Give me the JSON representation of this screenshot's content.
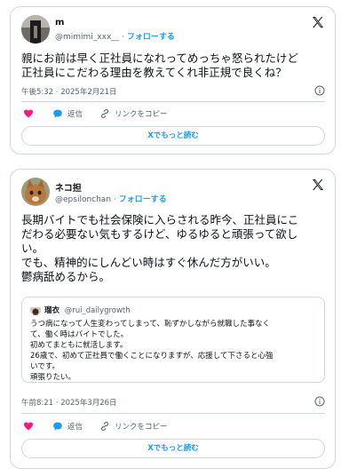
{
  "tweets": [
    {
      "user": {
        "name": "m",
        "handle": "@mimimi_xxx__",
        "follow_label": "フォローする"
      },
      "text": "親にお前は早く正社員になれってめっちゃ怒られたけど\n正社員にこだわる理由を教えてくれ非正規で良くね？",
      "timestamp": "午後5:32 · 2025年2月21日",
      "actions": {
        "reply": "返信",
        "copy_link": "リンクをコピー"
      },
      "read_more": "Xでもっと読む"
    },
    {
      "user": {
        "name": "ネコ担",
        "handle": "@epsilonchan",
        "follow_label": "フォローする"
      },
      "text": "長期バイトでも社会保険に入らされる昨今、正社員にこ\nだわる必要ない気もするけど、ゆるゆると頑張って欲し\nい。\nでも、精神的にしんどい時はすぐ休んだ方がいい。\n鬱病舐めるから。",
      "quote": {
        "name": "瑠衣",
        "handle": "@rui_dailygrowth",
        "text": "うつ病になって人生変わってしまって、恥ずかしながら就職した事なく\nて、働く時はバイトでした。\n初めてまともに就活します。\n26歳で、初めて正社員で働くことになりますが、応援して下さると心強\nいです。\n頑張りたい。"
      },
      "timestamp": "午前8:21 · 2025年3月26日",
      "actions": {
        "reply": "返信",
        "copy_link": "リンクをコピー"
      },
      "read_more": "Xでもっと読む"
    }
  ],
  "icons": {
    "x_logo": "x-logo-icon",
    "like": "heart-icon",
    "reply": "speech-bubble-icon",
    "link": "link-icon",
    "info": "info-icon"
  },
  "colors": {
    "accent": "#1d9bf0",
    "like": "#f91880",
    "muted": "#536471",
    "border": "#cfd9de"
  }
}
